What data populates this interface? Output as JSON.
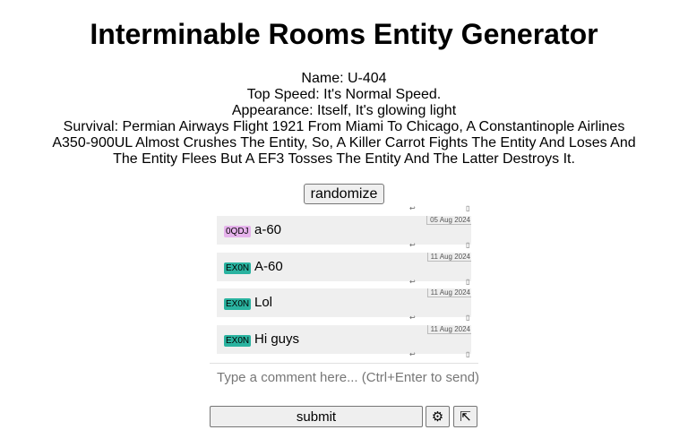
{
  "page": {
    "title": "Interminable Rooms Entity Generator"
  },
  "entity": {
    "name": "Name: U-404",
    "top_speed": "Top Speed: It's Normal Speed.",
    "appearance": "Appearance: Itself, It's glowing light",
    "survival": "Survival: Permian Airways Flight 1921 From Miami To Chicago, A Constantinople Airlines A350-900UL Almost Crushes The Entity, So, A Killer Carrot Fights The Entity And Loses And The Entity Flees But A EF3 Tosses The Entity And The Latter Destroys It."
  },
  "controls": {
    "randomize_label": "randomize"
  },
  "comments": [
    {
      "badge": "0QDJ",
      "badge_color": "#e6b3ec",
      "text": "a-60",
      "date": "05 Aug 2024"
    },
    {
      "badge": "EX0N",
      "badge_color": "#2ab3a0",
      "text": "A-60",
      "date": "11 Aug 2024"
    },
    {
      "badge": "EX0N",
      "badge_color": "#2ab3a0",
      "text": "Lol",
      "date": "11 Aug 2024"
    },
    {
      "badge": "EX0N",
      "badge_color": "#2ab3a0",
      "text": "Hi guys",
      "date": "11 Aug 2024"
    }
  ],
  "comment_actions": {
    "reply_glyph": "↩",
    "flag_glyph": "▯"
  },
  "comment_box": {
    "placeholder": "Type a comment here... (Ctrl+Enter to send)",
    "value": ""
  },
  "footer": {
    "submit_label": "submit",
    "settings_glyph": "⚙",
    "popout_glyph": "⇱"
  }
}
